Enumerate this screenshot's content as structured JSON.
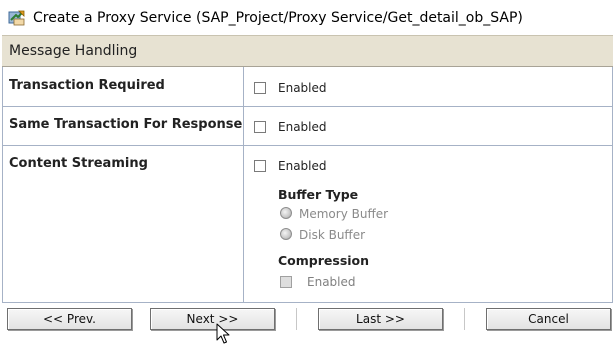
{
  "window": {
    "title": "Create a Proxy Service (SAP_Project/Proxy Service/Get_detail_ob_SAP)",
    "title_icon": "proxy-service-wizard-icon"
  },
  "section": {
    "title": "Message Handling"
  },
  "fields": {
    "transaction_required": {
      "label": "Transaction Required",
      "checkbox_label": "Enabled",
      "checked": false
    },
    "same_transaction": {
      "label": "Same Transaction For Response",
      "checkbox_label": "Enabled",
      "checked": false
    },
    "content_streaming": {
      "label": "Content Streaming",
      "checkbox_label": "Enabled",
      "checked": false
    }
  },
  "buffer_type": {
    "title": "Buffer Type",
    "options": [
      "Memory Buffer",
      "Disk Buffer"
    ],
    "disabled": true
  },
  "compression": {
    "title": "Compression",
    "checkbox_label": "Enabled",
    "disabled": true
  },
  "buttons": {
    "prev": "<< Prev.",
    "next": "Next >>",
    "last": "Last >>",
    "cancel": "Cancel"
  },
  "colors": {
    "section_header_bg": "#e7e2d2",
    "grid_line": "#a6b2c6"
  }
}
